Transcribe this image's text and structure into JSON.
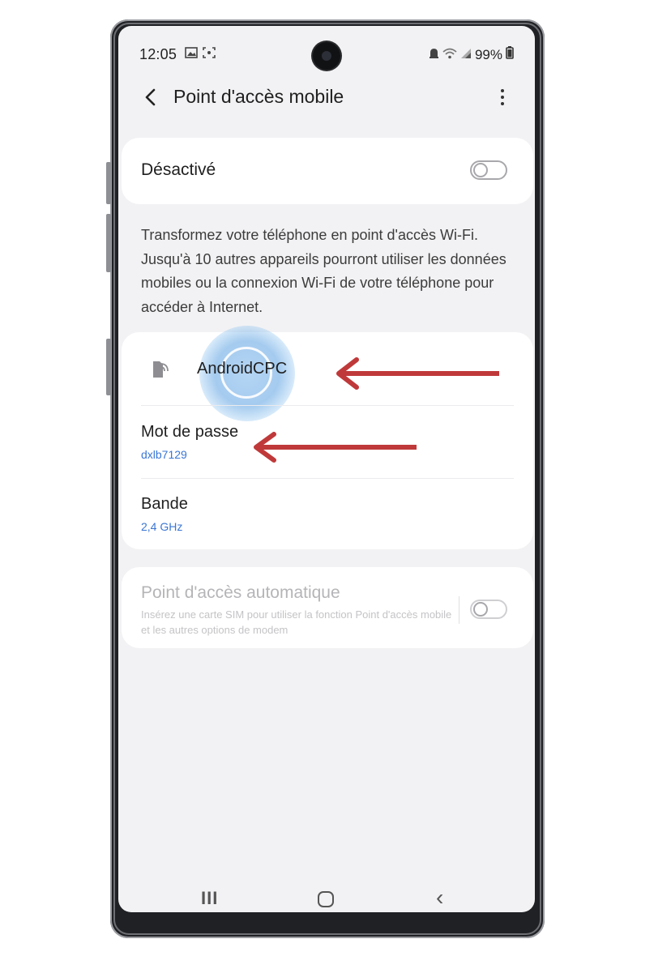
{
  "status_bar": {
    "time": "12:05",
    "left_icons": [
      "gallery-icon",
      "screenshot-icon"
    ],
    "battery": "99%",
    "right_icons": [
      "alarm-icon",
      "wifi-icon",
      "signal-icon",
      "battery-icon"
    ]
  },
  "header": {
    "title": "Point d'accès mobile",
    "back_icon": "chevron-left-icon",
    "more_icon": "more-vertical-icon"
  },
  "main_toggle": {
    "label": "Désactivé",
    "on": false
  },
  "description": "Transformez votre téléphone en point d'accès Wi-Fi. Jusqu'à 10 autres appareils pourront utiliser les données mobiles ou la connexion Wi-Fi de votre téléphone pour accéder à Internet.",
  "settings": {
    "ssid": "AndroidCPC",
    "password_label": "Mot de passe",
    "password_value": "dxlb7129",
    "band_label": "Bande",
    "band_value": "2,4 GHz"
  },
  "auto_hotspot": {
    "title": "Point d'accès automatique",
    "description": "Insérez une carte SIM pour utiliser la fonction Point d'accès mobile et les autres options de modem",
    "on": false
  },
  "nav_bar": {
    "recent": "III",
    "home_icon": "home-icon",
    "back": "‹"
  },
  "colors": {
    "accent_blue": "#3a76d4",
    "arrow_red": "#c0393a",
    "screen_bg": "#f2f2f4"
  }
}
